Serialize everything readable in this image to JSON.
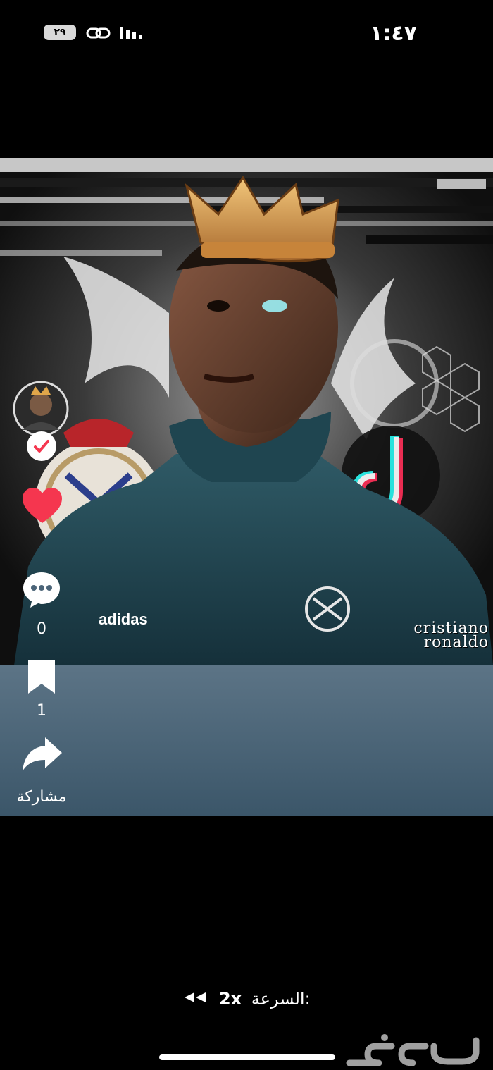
{
  "status_bar": {
    "time": "١:٤٧",
    "battery": "٢٩",
    "icons": [
      "link-icon",
      "signal-icon"
    ]
  },
  "video": {
    "watermark_line1": "cristiano",
    "watermark_line2": "ronaldo",
    "jersey_brand": "adidas"
  },
  "actions": {
    "comment_count": "0",
    "bookmark_count": "1",
    "share_label": "مشاركة",
    "like_color": "#f5364f"
  },
  "playback": {
    "speed_label": "السرعة:",
    "speed_value": "2x"
  },
  "brand": {
    "logo_text": "حراج"
  }
}
